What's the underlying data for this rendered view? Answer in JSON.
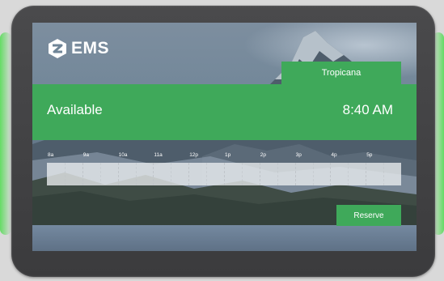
{
  "brand": {
    "name": "EMS",
    "icon": "ems-logo-icon"
  },
  "room": {
    "name": "Tropicana"
  },
  "status": {
    "label": "Available",
    "time": "8:40 AM"
  },
  "timeline": {
    "hours": [
      "8a",
      "9a",
      "10a",
      "11a",
      "12p",
      "1p",
      "2p",
      "3p",
      "4p",
      "5p"
    ]
  },
  "actions": {
    "reserve_label": "Reserve"
  },
  "colors": {
    "accent": "#3fa95a",
    "bezel": "#3e3e40",
    "glow": "#50dc50"
  }
}
